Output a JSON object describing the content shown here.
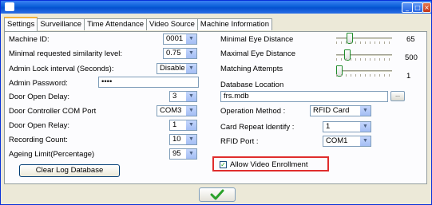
{
  "tabs": [
    {
      "label": "Settings"
    },
    {
      "label": "Surveillance"
    },
    {
      "label": "Time Attendance"
    },
    {
      "label": "Video Source"
    },
    {
      "label": "Machine Information"
    }
  ],
  "left": {
    "machine_id": {
      "label": "Machine ID:",
      "value": "0001"
    },
    "similarity": {
      "label": "Minimal requested similarity level:",
      "value": "0.75"
    },
    "admin_lock": {
      "label": "Admin Lock interval (Seconds):",
      "value": "Disable"
    },
    "admin_password": {
      "label": "Admin Password:",
      "value": "••••"
    },
    "door_open_delay": {
      "label": "Door Open Delay:",
      "value": "3"
    },
    "door_com_port": {
      "label": "Door Controller COM Port",
      "value": "COM3"
    },
    "door_open_relay": {
      "label": "Door Open Relay:",
      "value": "1"
    },
    "recording_count": {
      "label": "Recording Count:",
      "value": "10"
    },
    "ageing_limit": {
      "label": "Ageing Limit(Percentage)",
      "value": "95"
    },
    "clear_log_button": "Clear Log Database"
  },
  "right": {
    "min_eye": {
      "label": "Minimal Eye Distance",
      "value": "65"
    },
    "max_eye": {
      "label": "Maximal Eye Distance",
      "value": "500"
    },
    "matching": {
      "label": "Matching Attempts",
      "value": "1"
    },
    "database_location": {
      "label": "Database Location",
      "value": "frs.mdb",
      "browse": "..."
    },
    "operation_method": {
      "label": "Operation Method :",
      "value": "RFID Card"
    },
    "card_repeat": {
      "label": "Card Repeat Identify :",
      "value": "1"
    },
    "rfid_port": {
      "label": "RFID Port :",
      "value": "COM1"
    },
    "allow_video": {
      "label": "Allow Video Enrollment",
      "checked": true
    }
  },
  "icons": {
    "ok": "checkmark-icon"
  }
}
